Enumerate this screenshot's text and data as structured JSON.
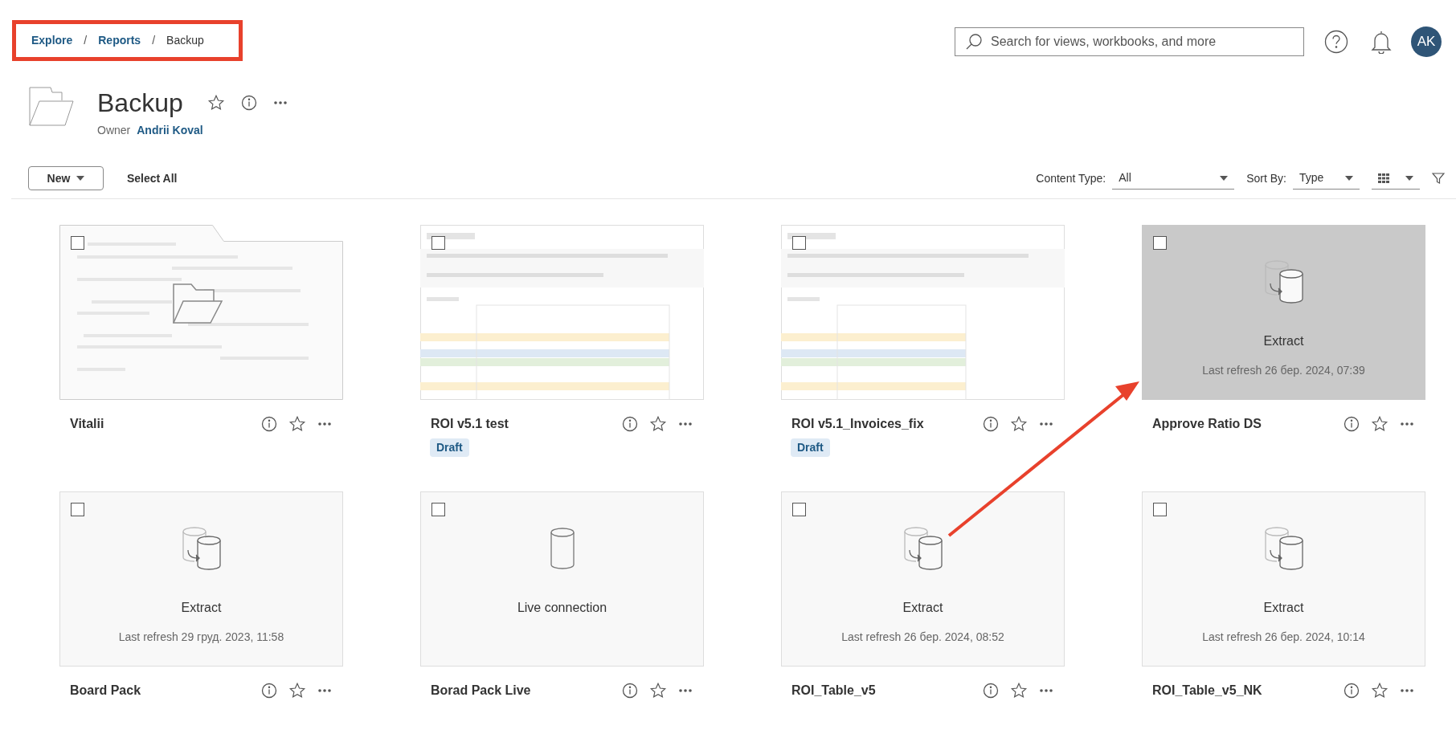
{
  "breadcrumb": [
    {
      "label": "Explore",
      "link": true
    },
    {
      "label": "Reports",
      "link": true
    },
    {
      "label": "Backup",
      "link": false
    }
  ],
  "breadcrumb_separator": "/",
  "search": {
    "placeholder": "Search for views, workbooks, and more"
  },
  "user": {
    "initials": "AK"
  },
  "folder": {
    "title": "Backup",
    "owner_label": "Owner",
    "owner": "Andrii Koval"
  },
  "toolbar": {
    "new_button": "New",
    "select_all": "Select All",
    "content_type": {
      "label": "Content Type:",
      "value": "All"
    },
    "sort_by": {
      "label": "Sort By:",
      "value": "Type"
    }
  },
  "items": [
    {
      "kind": "folder",
      "name": "Vitalii",
      "checked": false
    },
    {
      "kind": "workbook",
      "name": "ROI v5.1 test",
      "badge": "Draft",
      "checked": false
    },
    {
      "kind": "workbook",
      "name": "ROI v5.1_Invoices_fix",
      "badge": "Draft",
      "checked": false
    },
    {
      "kind": "datasource",
      "name": "Approve Ratio DS",
      "live": false,
      "connection": "Extract",
      "refresh": "Last refresh 26 бер. 2024, 07:39",
      "highlighted": true,
      "checked": false
    },
    {
      "kind": "datasource",
      "name": "Board Pack",
      "live": false,
      "connection": "Extract",
      "refresh": "Last refresh 29 груд. 2023, 11:58",
      "highlighted": false,
      "checked": false
    },
    {
      "kind": "datasource",
      "name": "Borad Pack Live",
      "live": true,
      "connection": "Live connection",
      "highlighted": false,
      "checked": false
    },
    {
      "kind": "datasource",
      "name": "ROI_Table_v5",
      "live": false,
      "connection": "Extract",
      "refresh": "Last refresh 26 бер. 2024, 08:52",
      "highlighted": false,
      "checked": false
    },
    {
      "kind": "datasource",
      "name": "ROI_Table_v5_NK",
      "live": false,
      "connection": "Extract",
      "refresh": "Last refresh 26 бер. 2024, 10:14",
      "highlighted": false,
      "checked": false
    }
  ]
}
